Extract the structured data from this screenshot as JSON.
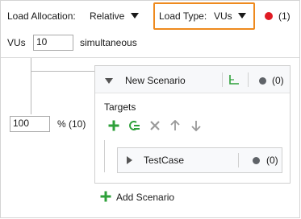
{
  "load_allocation": {
    "label": "Load Allocation:",
    "value": "Relative"
  },
  "load_type": {
    "label": "Load Type:",
    "value": "VUs"
  },
  "error_count": "(1)",
  "vus": {
    "label": "VUs",
    "value": "10",
    "suffix": "simultaneous"
  },
  "percentage": {
    "value": "100",
    "label": "% (10)"
  },
  "scenario": {
    "title": "New Scenario",
    "count": "(0)",
    "targets_label": "Targets"
  },
  "testcase": {
    "name": "TestCase",
    "count": "(0)"
  },
  "add_scenario_label": "Add Scenario",
  "icons": [
    "chevron-down-icon",
    "chart-axes-icon",
    "status-dot-icon",
    "add-icon",
    "refresh-icon",
    "remove-icon",
    "move-up-icon",
    "move-down-icon",
    "chevron-right-icon",
    "error-dot-icon"
  ],
  "colors": {
    "highlight": "#ee8a1e",
    "error": "#e01b24",
    "add_green": "#2ea03a"
  }
}
